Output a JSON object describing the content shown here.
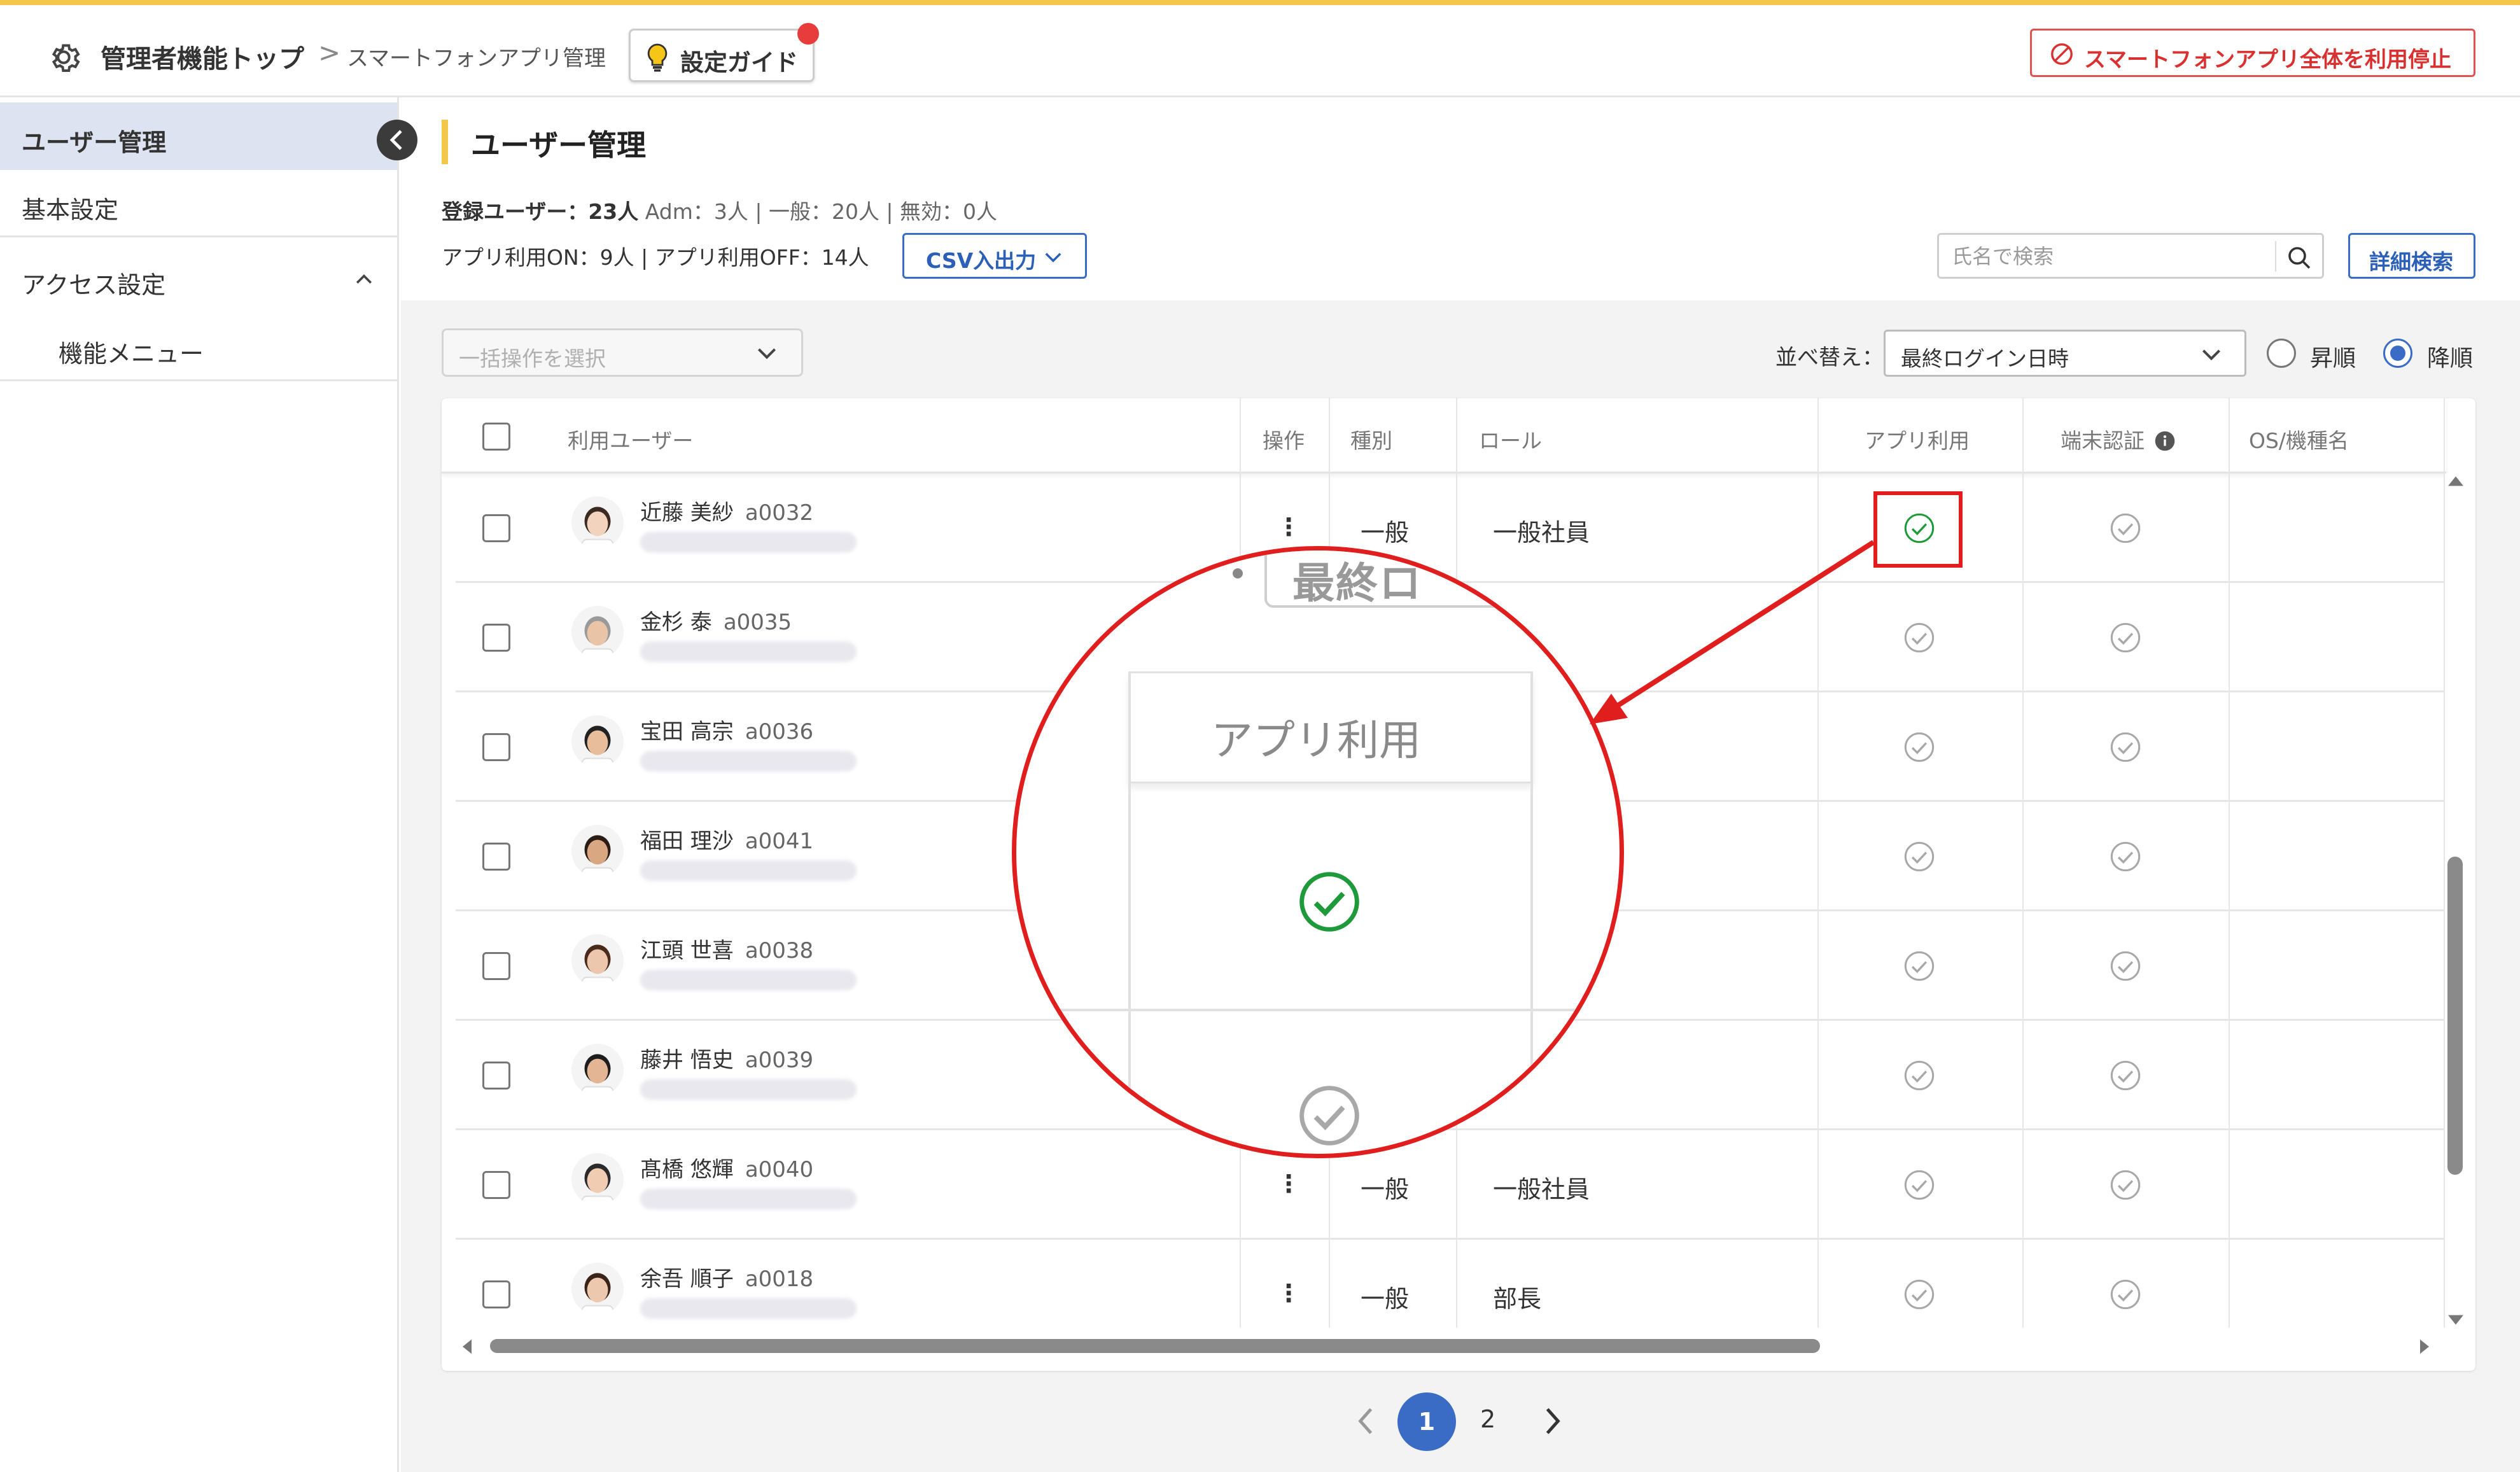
{
  "header": {
    "breadcrumb_top": "管理者機能トップ",
    "breadcrumb_sep": ">",
    "breadcrumb_current": "スマートフォンアプリ管理",
    "guide_label": "設定ガイド",
    "stop_label": "スマートフォンアプリ全体を利用停止"
  },
  "sidebar": {
    "items": [
      {
        "label": "ユーザー管理"
      },
      {
        "label": "基本設定"
      },
      {
        "label": "アクセス設定"
      },
      {
        "label": "機能メニュー"
      }
    ]
  },
  "main": {
    "title": "ユーザー管理",
    "stats_registered": "登録ユーザー：23人",
    "stats_breakdown": "Adm：3人 | 一般：20人 | 無効：0人",
    "stats_app": "アプリ利用ON：9人 | アプリ利用OFF：14人",
    "csv_label": "CSV入出力",
    "search_placeholder": "氏名で検索",
    "advanced_search_label": "詳細検索",
    "bulk_placeholder": "一括操作を選択",
    "sort_label": "並べ替え：",
    "sort_value": "最終ログイン日時",
    "order_asc": "昇順",
    "order_desc": "降順",
    "order_selected": "desc"
  },
  "table": {
    "columns": [
      "利用ユーザー",
      "操作",
      "種別",
      "ロール",
      "アプリ利用",
      "端末認証",
      "OS/機種名"
    ],
    "rows": [
      {
        "name": "近藤 美紗",
        "code": "a0032",
        "op": "⋮",
        "type": "一般",
        "role": "一般社員",
        "app_on": true,
        "device_auth": false
      },
      {
        "name": "金杉 泰",
        "code": "a0035",
        "op": "",
        "type": "",
        "role": "",
        "app_on": false,
        "device_auth": false
      },
      {
        "name": "宝田 高宗",
        "code": "a0036",
        "op": "",
        "type": "",
        "role": "",
        "app_on": false,
        "device_auth": false
      },
      {
        "name": "福田 理沙",
        "code": "a0041",
        "op": "",
        "type": "",
        "role": "",
        "app_on": false,
        "device_auth": false
      },
      {
        "name": "江頭 世喜",
        "code": "a0038",
        "op": "",
        "type": "",
        "role": "",
        "app_on": false,
        "device_auth": false
      },
      {
        "name": "藤井 悟史",
        "code": "a0039",
        "op": "",
        "type": "",
        "role": "",
        "app_on": false,
        "device_auth": false
      },
      {
        "name": "髙橋 悠輝",
        "code": "a0040",
        "op": "⋮",
        "type": "一般",
        "role": "一般社員",
        "app_on": false,
        "device_auth": false
      },
      {
        "name": "余吾 順子",
        "code": "a0018",
        "op": "⋮",
        "type": "一般",
        "role": "部長",
        "app_on": false,
        "device_auth": false
      }
    ]
  },
  "pagination": {
    "pages": [
      "1",
      "2"
    ],
    "current": "1",
    "prev": "‹",
    "next": "›"
  },
  "zoom_callout": {
    "fragment_label": "最終ロ",
    "column_label": "アプリ利用"
  },
  "colors": {
    "accent": "#3a6cc5",
    "highlight": "#e11e1e",
    "check_on": "#1f9a3a",
    "check_off": "#a8a8a8",
    "brand_yellow": "#f3c84a"
  }
}
